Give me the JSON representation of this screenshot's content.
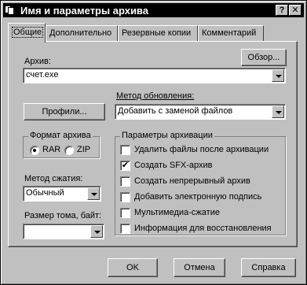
{
  "window": {
    "title": "Имя и параметры архива",
    "help_glyph": "?",
    "close_glyph": "✕"
  },
  "tabs": [
    {
      "label": "Общие",
      "active": true
    },
    {
      "label": "Дополнительно",
      "active": false
    },
    {
      "label": "Резервные копии",
      "active": false
    },
    {
      "label": "Комментарий",
      "active": false
    }
  ],
  "archive": {
    "label": "Архив:",
    "value": "счет.exe",
    "browse_button": "Обзор..."
  },
  "profiles_button": "Профили...",
  "update_method": {
    "label": "Метод обновления:",
    "value": "Добавить с заменой файлов"
  },
  "archive_format": {
    "title": "Формат архива",
    "options": [
      {
        "label": "RAR",
        "selected": true
      },
      {
        "label": "ZIP",
        "selected": false
      }
    ]
  },
  "compression": {
    "label": "Метод сжатия:",
    "value": "Обычный"
  },
  "volume_size": {
    "label": "Размер тома, байт:",
    "value": ""
  },
  "archive_options": {
    "title": "Параметры архивации",
    "items": [
      {
        "label": "Удалить файлы после архивации",
        "checked": false
      },
      {
        "label": "Создать SFX-архив",
        "checked": true
      },
      {
        "label": "Создать непрерывный архив",
        "checked": false
      },
      {
        "label": "Добавить электронную подпись",
        "checked": false
      },
      {
        "label": "Мультимедиа-сжатие",
        "checked": false
      },
      {
        "label": "Информация для восстановления",
        "checked": false
      }
    ]
  },
  "buttons": {
    "ok": "OK",
    "cancel": "Отмена",
    "help": "Справка"
  },
  "check_glyph": "✔"
}
